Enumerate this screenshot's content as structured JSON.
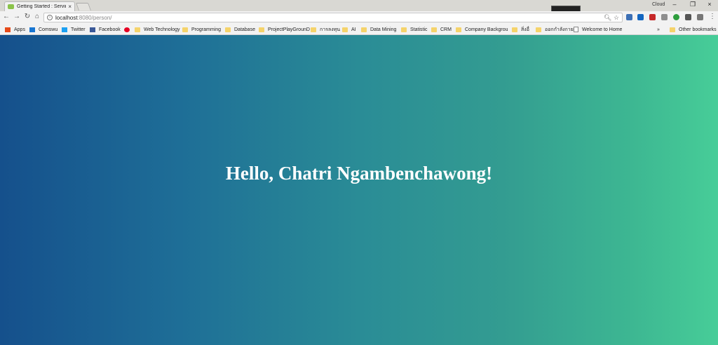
{
  "browser": {
    "tab_title": "Getting Started : Serving",
    "tab_close": "×",
    "profile": "Cloud",
    "window_controls": {
      "minimize": "–",
      "restore": "❐",
      "close": "×"
    },
    "nav": {
      "back": "←",
      "forward": "→",
      "reload": "↻",
      "home": "⌂"
    },
    "url_host": "localhost",
    "url_path": ":8080/person/",
    "menu": "⋮",
    "extensions": [
      {
        "name": "ext-1",
        "color": "#3c6fb5"
      },
      {
        "name": "ext-2",
        "color": "#1466c0"
      },
      {
        "name": "ext-3",
        "color": "#c62828"
      },
      {
        "name": "ext-4",
        "color": "#8e8e8e"
      },
      {
        "name": "ext-5",
        "color": "#2e9e3e"
      },
      {
        "name": "ext-6",
        "color": "#555555"
      },
      {
        "name": "ext-7",
        "color": "#777777"
      }
    ]
  },
  "bookmarks": {
    "items": [
      {
        "label": "Apps",
        "icon": "apps-icon",
        "color": "#e64a19"
      },
      {
        "label": "Comswu",
        "icon": "comswu-icon",
        "color": "#1976d2"
      },
      {
        "label": "Twitter",
        "icon": "twitter-icon",
        "color": "#1da1f2"
      },
      {
        "label": "Facebook",
        "icon": "facebook-icon",
        "color": "#3b5998"
      },
      {
        "label": "",
        "icon": "pinterest-icon",
        "color": "#e60023"
      },
      {
        "label": "Web Technology",
        "icon": "folder-icon"
      },
      {
        "label": "Programming",
        "icon": "folder-icon"
      },
      {
        "label": "Database",
        "icon": "folder-icon"
      },
      {
        "label": "ProjectPlayGrounD",
        "icon": "folder-icon"
      },
      {
        "label": "การลงทุน",
        "icon": "folder-icon"
      },
      {
        "label": "AI",
        "icon": "folder-icon"
      },
      {
        "label": "Data Mining",
        "icon": "folder-icon"
      },
      {
        "label": "Statistic",
        "icon": "folder-icon"
      },
      {
        "label": "CRM",
        "icon": "folder-icon"
      },
      {
        "label": "Company Backgrou",
        "icon": "folder-icon"
      },
      {
        "label": "สิ่งอื่",
        "icon": "folder-icon"
      },
      {
        "label": "ออกกำลังกาย",
        "icon": "folder-icon"
      },
      {
        "label": "Welcome to Home",
        "icon": "page-icon"
      }
    ],
    "overflow": "»",
    "other": "Other bookmarks"
  },
  "page": {
    "greeting": "Hello, Chatri Ngambenchawong!",
    "gradient_start": "#15508c",
    "gradient_end": "#47cd98"
  }
}
